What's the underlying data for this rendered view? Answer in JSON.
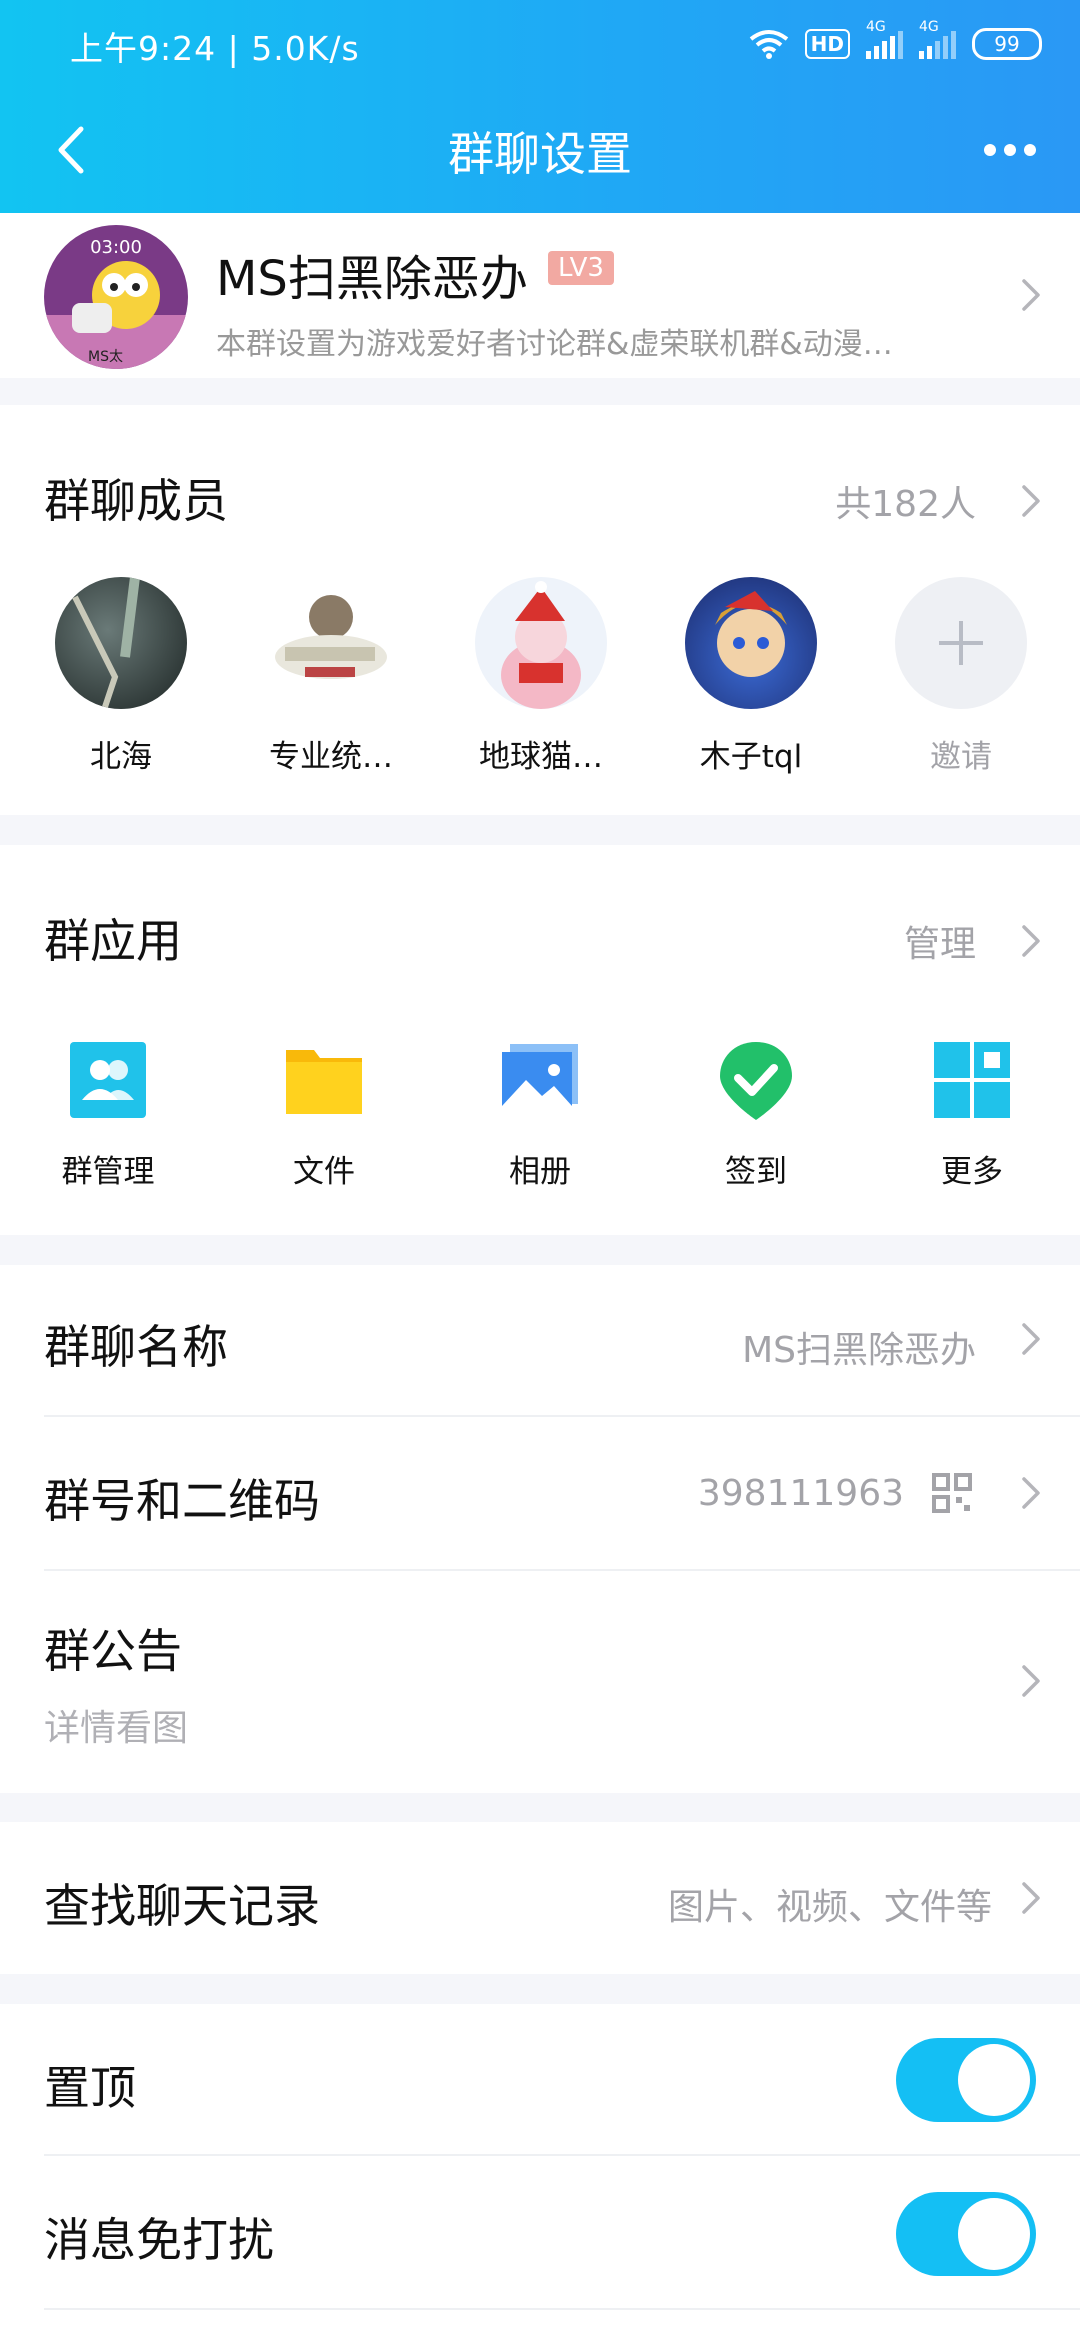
{
  "status_bar": {
    "time": "上午9:24 | 5.0K/s",
    "hd": "HD",
    "net1": "4G",
    "net2": "4G",
    "battery": "99"
  },
  "nav": {
    "title": "群聊设置"
  },
  "group": {
    "avatar_time": "03:00",
    "avatar_caption": "MS太",
    "name": "MS扫黑除恶办",
    "level": "LV3",
    "description": "本群设置为游戏爱好者讨论群&虚荣联机群&动漫…"
  },
  "members": {
    "title": "群聊成员",
    "count": "共182人",
    "list": [
      {
        "name": "北海"
      },
      {
        "name": "专业统…"
      },
      {
        "name": "地球猫…"
      },
      {
        "name": "木子tql"
      }
    ],
    "invite": "邀请"
  },
  "apps": {
    "title": "群应用",
    "manage": "管理",
    "items": [
      {
        "name": "群管理",
        "icon": "group-manage-icon"
      },
      {
        "name": "文件",
        "icon": "folder-icon"
      },
      {
        "name": "相册",
        "icon": "album-icon"
      },
      {
        "name": "签到",
        "icon": "checkin-icon"
      },
      {
        "name": "更多",
        "icon": "more-apps-icon"
      }
    ]
  },
  "info": {
    "name_label": "群聊名称",
    "name_value": "MS扫黑除恶办",
    "number_label": "群号和二维码",
    "number_value": "398111963",
    "notice_label": "群公告",
    "notice_value": "详情看图"
  },
  "search": {
    "label": "查找聊天记录",
    "hint": "图片、视频、文件等"
  },
  "settings": {
    "pin_label": "置顶",
    "pin_on": true,
    "mute_label": "消息免打扰",
    "mute_on": true
  },
  "colors": {
    "accent": "#14bff4",
    "nav_bg": "#1fa9f5",
    "level_badge": "#f2a9a2"
  }
}
